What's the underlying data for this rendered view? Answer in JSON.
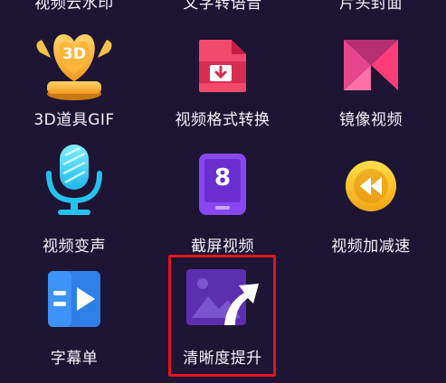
{
  "grid": {
    "row0": {
      "col0_label": "视频云水印",
      "col1_label": "文字转语音",
      "col2_label": "片头封面"
    },
    "row1": {
      "col0_label": "3D道具GIF",
      "col0_icon_text": "3D",
      "col1_label": "视频格式转换",
      "col2_label": "镜像视频"
    },
    "row2": {
      "col0_label": "视频变声",
      "col1_label": "截屏视频",
      "col1_icon_text": "8",
      "col2_label": "视频加减速"
    },
    "row3": {
      "col0_label": "字幕单",
      "col1_label": "清晰度提升"
    }
  },
  "colors": {
    "background": "#1d1533",
    "highlight_border": "#e4131e"
  }
}
